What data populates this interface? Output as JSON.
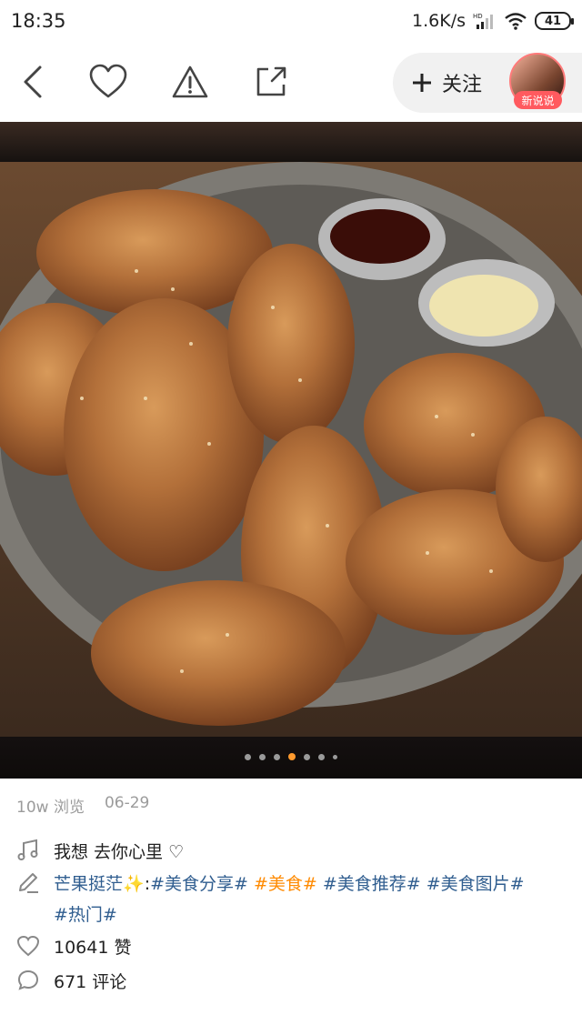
{
  "status_bar": {
    "time": "18:35",
    "net_speed": "1.6K/s",
    "battery": "41"
  },
  "toolbar": {
    "icons": [
      "back-icon",
      "heart-icon",
      "warning-icon",
      "share-icon"
    ],
    "follow_label": "关注",
    "avatar_badge": "新说说"
  },
  "gallery": {
    "photo_count": 7,
    "active_index": 3
  },
  "post": {
    "views": "10w 浏览",
    "date": "06-29",
    "music": "我想  去你心里 ♡",
    "author": "芒果挺茫",
    "author_emoji": "✨",
    "tags_line1": [
      {
        "text": "#美食分享#",
        "hot": false
      },
      {
        "text": "#美食#",
        "hot": true
      },
      {
        "text": "#美食推荐#",
        "hot": false
      },
      {
        "text": "#美食图片#",
        "hot": false
      }
    ],
    "tags_line2": [
      {
        "text": "#热门#",
        "hot": false
      }
    ],
    "likes": "10641 赞",
    "comments": "671 评论"
  }
}
